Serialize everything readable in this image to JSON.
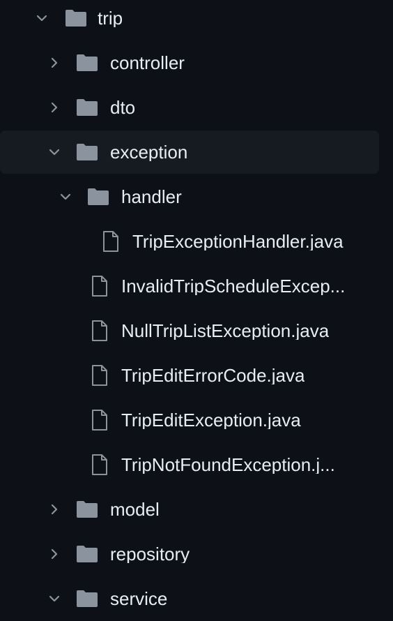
{
  "tree": {
    "root": {
      "label": "trip",
      "expanded": true
    },
    "children": {
      "controller": {
        "label": "controller",
        "expanded": false
      },
      "dto": {
        "label": "dto",
        "expanded": false
      },
      "exception": {
        "label": "exception",
        "expanded": true,
        "selected": true,
        "handler": {
          "label": "handler",
          "expanded": true,
          "files": [
            "TripExceptionHandler.java"
          ]
        },
        "files": [
          "InvalidTripScheduleExcep...",
          "NullTripListException.java",
          "TripEditErrorCode.java",
          "TripEditException.java",
          "TripNotFoundException.j..."
        ]
      },
      "model": {
        "label": "model",
        "expanded": false
      },
      "repository": {
        "label": "repository",
        "expanded": false
      },
      "service": {
        "label": "service",
        "expanded": true
      }
    }
  },
  "colors": {
    "background": "#0d1117",
    "selected_row": "#161b22",
    "text": "#e6edf3",
    "icon": "#8b949e"
  },
  "icons": {
    "folder": "folder-icon",
    "file": "file-icon",
    "collapsed": "chevron-right-icon",
    "expanded": "chevron-down-icon"
  }
}
